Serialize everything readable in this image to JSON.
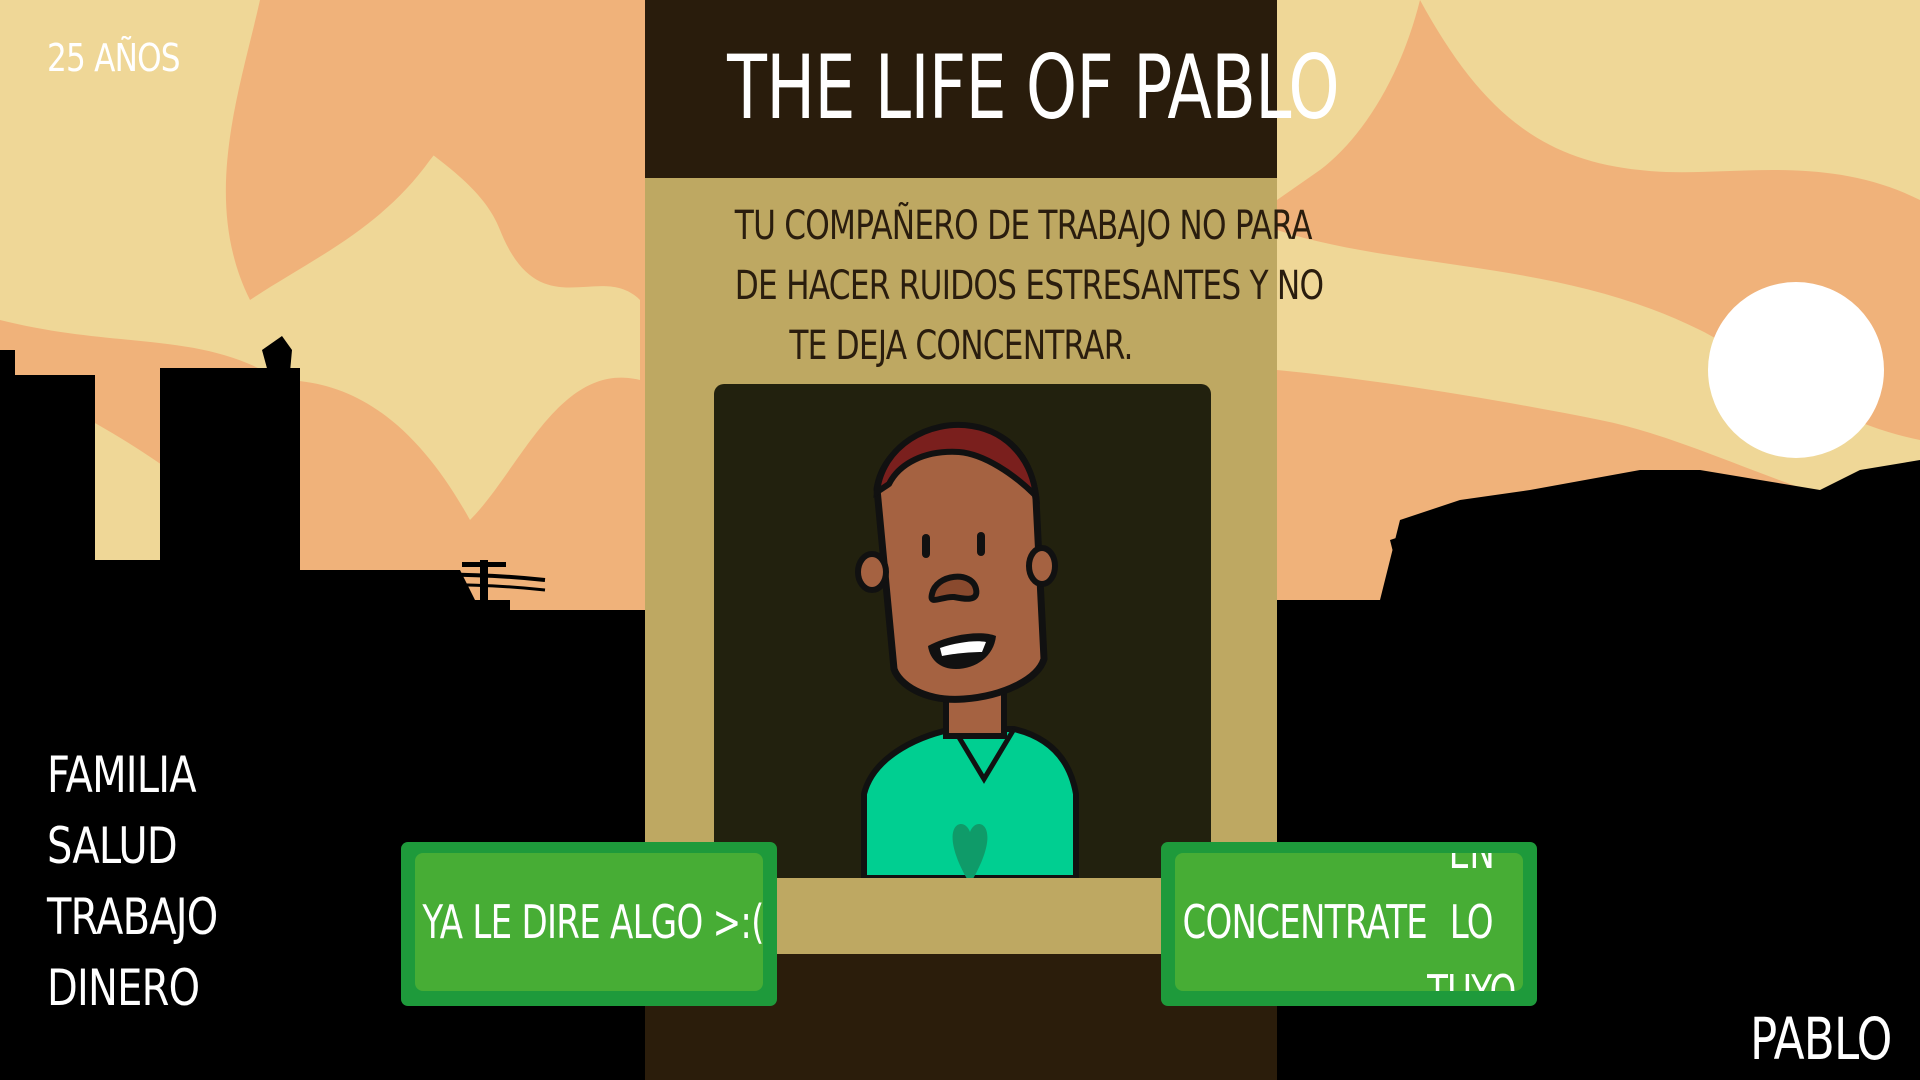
{
  "hud": {
    "age": "25 AÑOS",
    "player_name": "PABLO"
  },
  "stats": [
    "FAMILIA",
    "SALUD",
    "TRABAJO",
    "DINERO"
  ],
  "card": {
    "title": "THE LIFE OF PABLO",
    "event_lines": [
      "TU COMPAÑERO DE TRABAJO NO PARA",
      "DE HACER RUIDOS ESTRESANTES Y NO",
      "TE DEJA CONCENTRAR."
    ]
  },
  "choices": {
    "left": "YA LE DIRE ALGO >:(",
    "right_line1": "CONCENTRATE",
    "right_line2": "EN LO TUYO"
  },
  "colors": {
    "sky": "#f0b27a",
    "cloud": "#efd797",
    "silhouette": "#000000",
    "card": "#bea862",
    "card_header": "#291c0c",
    "button_border": "#1e9a3b",
    "button_fill": "#47ad35",
    "shirt": "#00cf91"
  }
}
